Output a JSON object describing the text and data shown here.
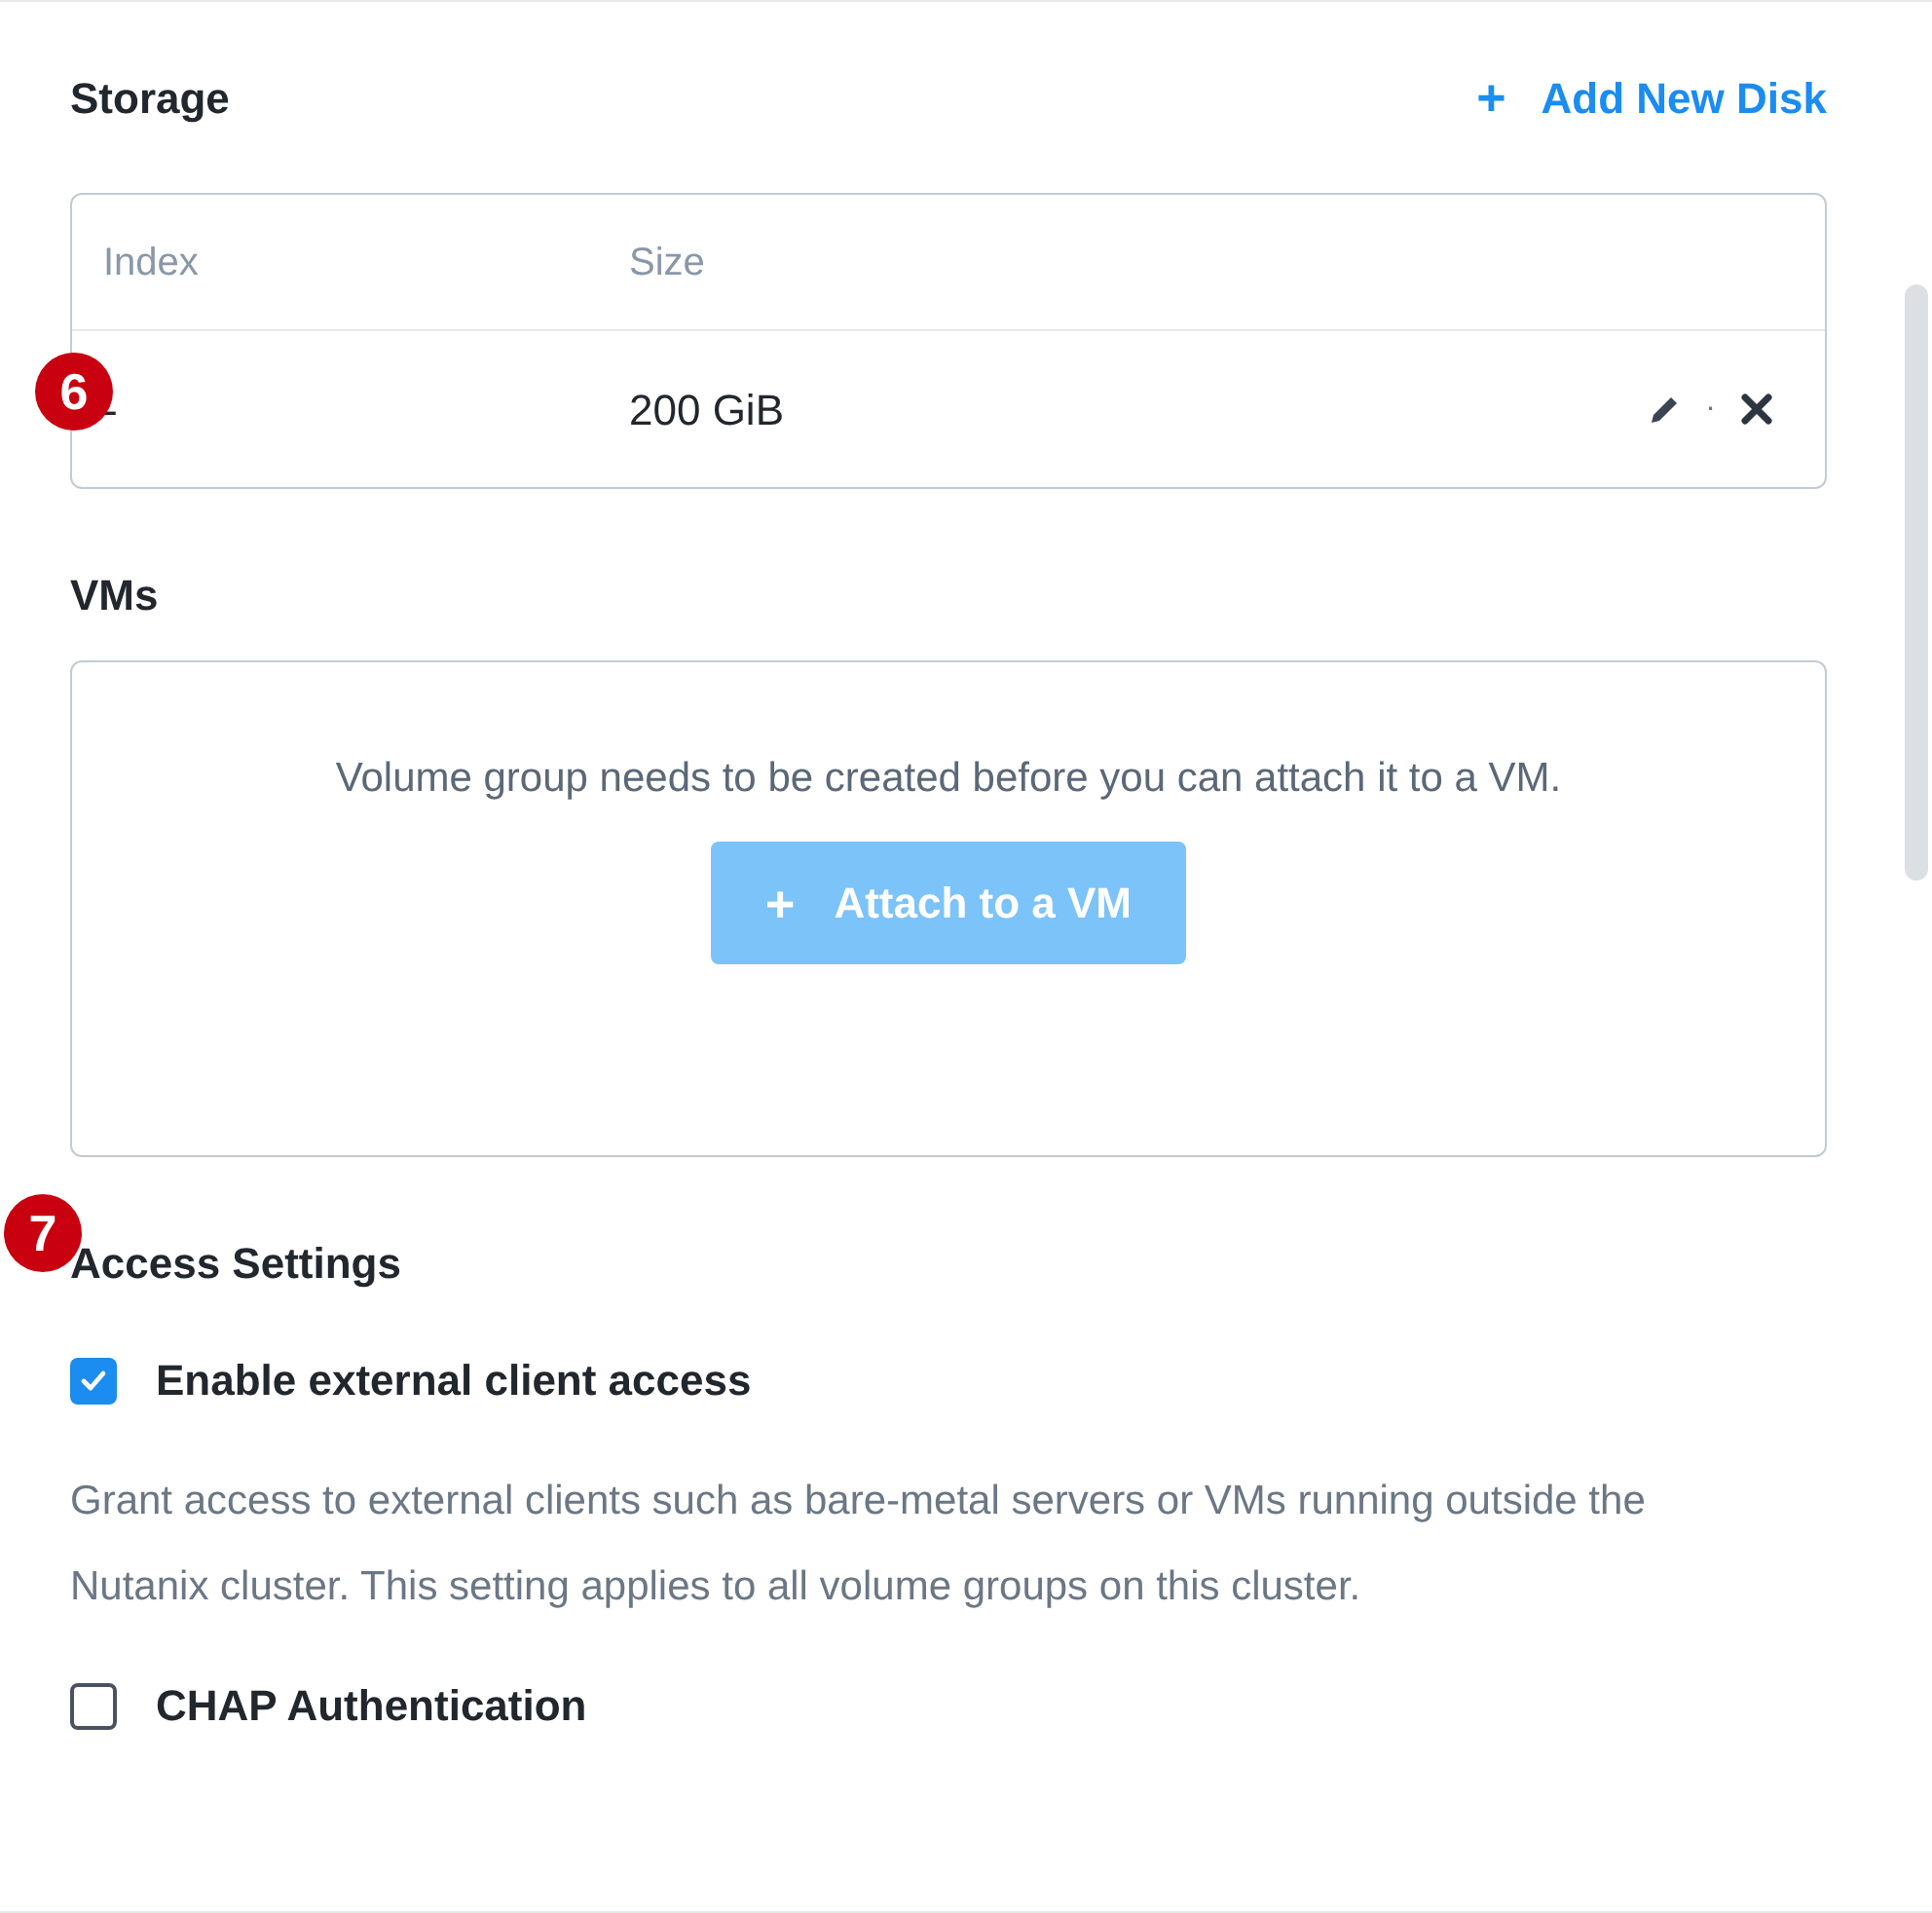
{
  "storage": {
    "title": "Storage",
    "add_link": {
      "icon": "+",
      "label": "Add New Disk"
    },
    "table": {
      "columns": [
        "Index",
        "Size"
      ],
      "rows": [
        {
          "index": "-",
          "size": "200 GiB",
          "separator": "·"
        }
      ]
    }
  },
  "vms": {
    "title": "VMs",
    "message": "Volume group needs to be created before you can attach it to a VM.",
    "button": {
      "icon": "+",
      "label": "Attach to a VM",
      "disabled": true
    }
  },
  "access_settings": {
    "title": "Access Settings",
    "options": [
      {
        "label": "Enable external client access",
        "checked": true
      },
      {
        "kind": "description",
        "text": "Grant access to external clients such as bare-metal servers or VMs running outside the Nutanix cluster. This setting applies to all volume groups on this cluster."
      },
      {
        "label": "CHAP Authentication",
        "checked": false
      }
    ]
  },
  "callouts": [
    {
      "number": "6"
    },
    {
      "number": "7"
    }
  ]
}
